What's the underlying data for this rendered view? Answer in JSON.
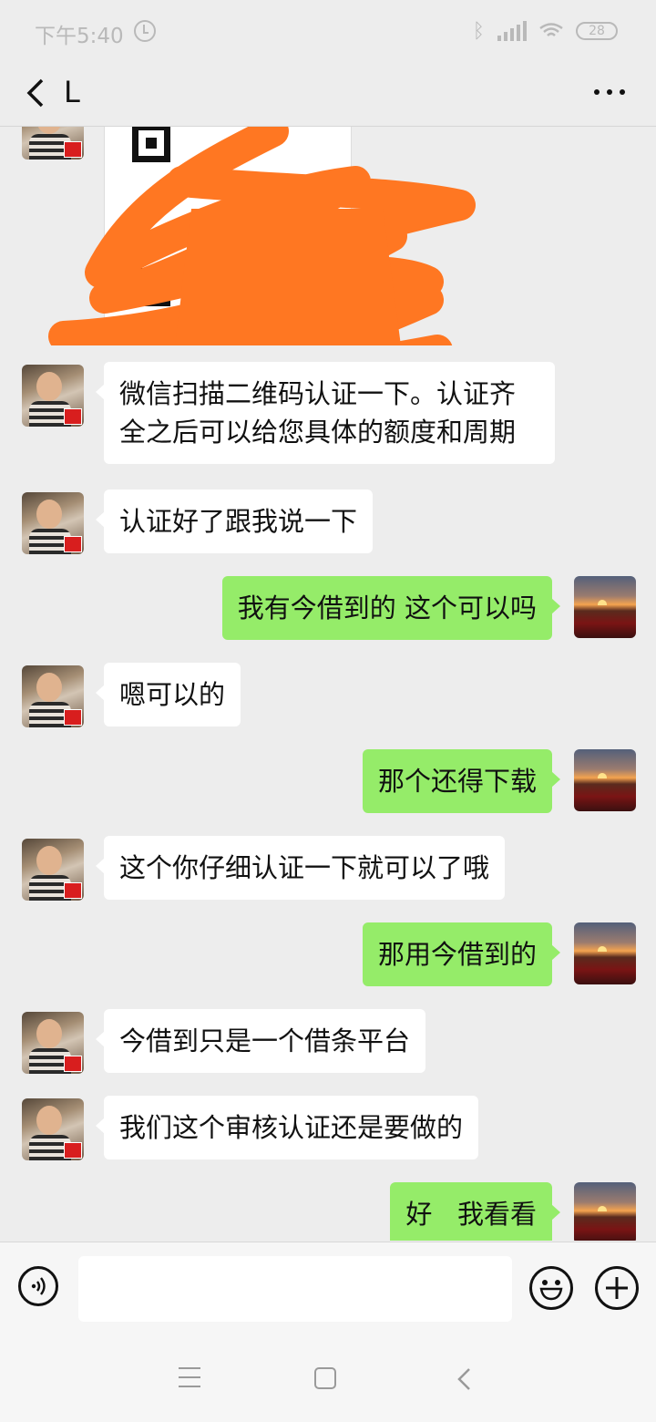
{
  "status_bar": {
    "time": "下午5:40",
    "battery": "28"
  },
  "header": {
    "title": "L"
  },
  "messages": [
    {
      "side": "left",
      "text_lines": [
        "微信扫描二维码认证一下。认证齐",
        "全之后可以给您具体的额度和周期"
      ]
    },
    {
      "side": "left",
      "text": "认证好了跟我说一下"
    },
    {
      "side": "right",
      "text": "我有今借到的  这个可以吗"
    },
    {
      "side": "left",
      "text": "嗯可以的"
    },
    {
      "side": "right",
      "text": "那个还得下载"
    },
    {
      "side": "left",
      "text": "这个你仔细认证一下就可以了哦"
    },
    {
      "side": "right",
      "text": "那用今借到的"
    },
    {
      "side": "left",
      "text": "今借到只是一个借条平台"
    },
    {
      "side": "left",
      "text": "我们这个审核认证还是要做的"
    },
    {
      "side": "right",
      "text": "好   我看看"
    }
  ],
  "input": {
    "value": "",
    "placeholder": ""
  },
  "colors": {
    "background": "#ededed",
    "sent_bubble": "#95ec69",
    "received_bubble": "#ffffff",
    "redaction": "#ff7722"
  },
  "icons": [
    "back-icon",
    "more-icon",
    "voice-icon",
    "emoji-icon",
    "plus-icon",
    "nav-menu-icon",
    "nav-home-icon",
    "nav-back-icon"
  ]
}
